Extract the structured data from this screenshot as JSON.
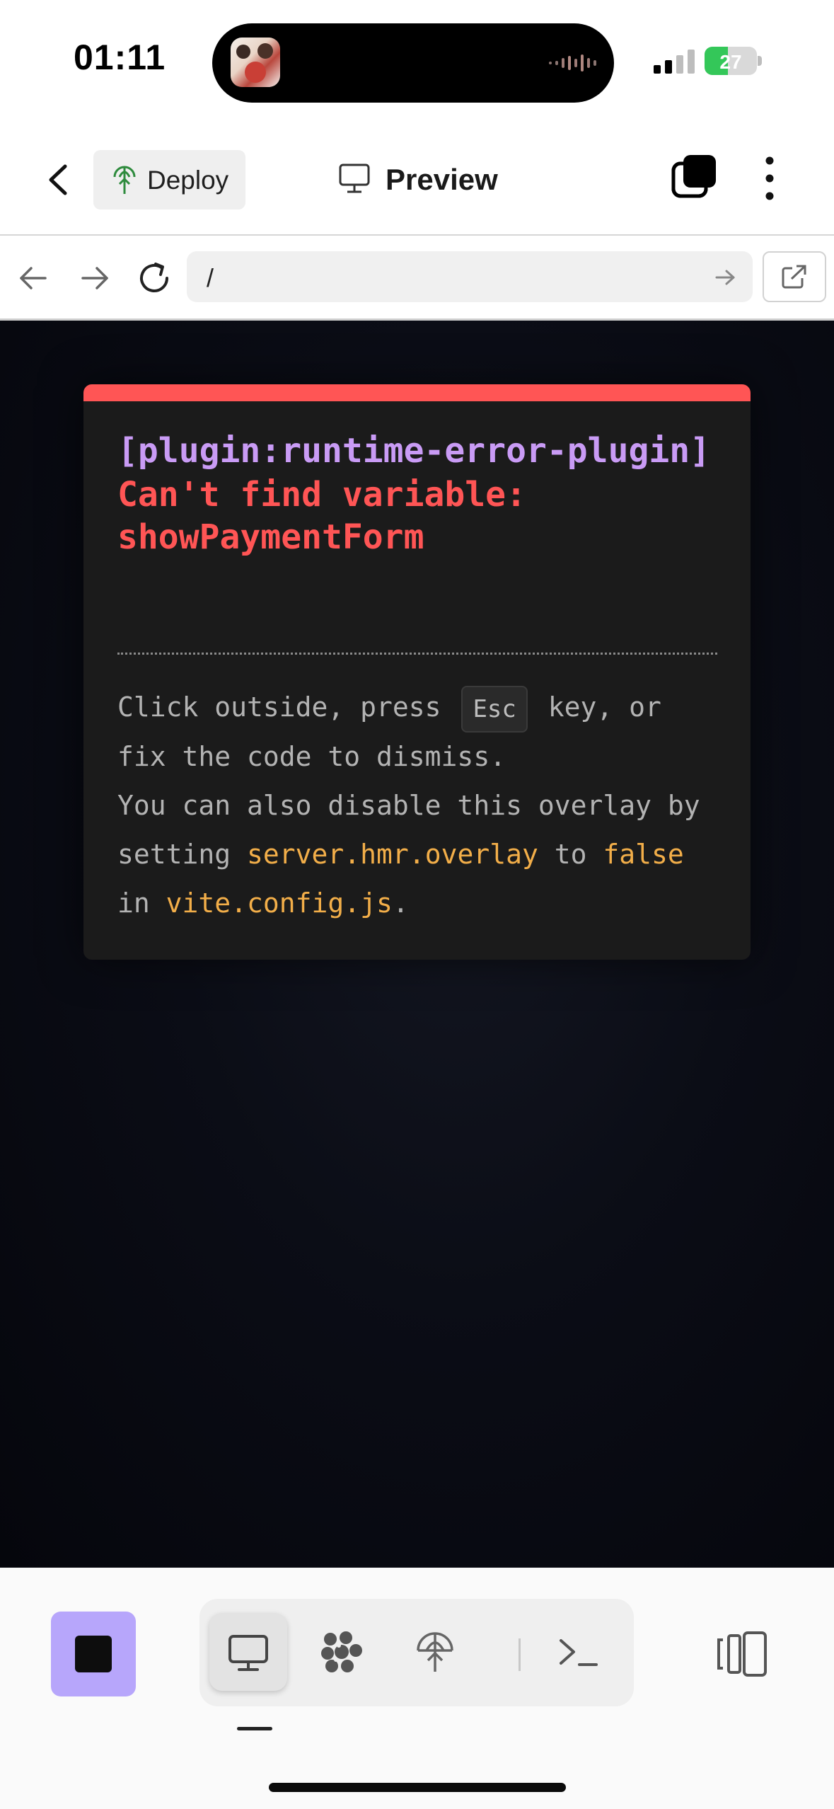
{
  "status_bar": {
    "time": "01:11",
    "battery": "27"
  },
  "header": {
    "deploy_label": "Deploy",
    "title": "Preview"
  },
  "browser": {
    "url": "/"
  },
  "overlay": {
    "plugin": "[plugin:runtime-error-plugin]",
    "message": "Can't find variable: showPaymentForm",
    "tip_1": "Click outside, press ",
    "tip_key": "Esc",
    "tip_2": " key, or fix the code to dismiss.",
    "tip_3": "You can also disable this overlay by setting ",
    "tip_code_1": "server.hmr.overlay",
    "tip_4": " to ",
    "tip_code_2": "false",
    "tip_5": " in ",
    "tip_code_3": "vite.config.js",
    "tip_6": "."
  },
  "colors": {
    "accent_stop": "#b7a6fb",
    "error_red": "#ff5555",
    "plugin_purple": "#c99bf5",
    "code_orange": "#f2ae49"
  },
  "toolbar": {
    "icons": [
      "stop-icon",
      "desktop-icon",
      "network-icon",
      "deploy-icon",
      "terminal-icon",
      "split-view-icon"
    ]
  }
}
